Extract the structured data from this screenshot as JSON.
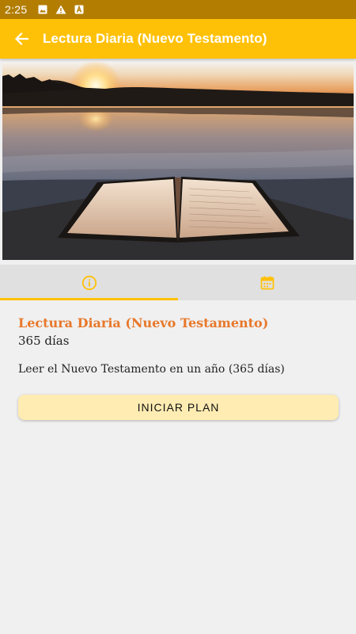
{
  "status_bar": {
    "time": "2:25",
    "icons": [
      "image-icon",
      "warning-icon",
      "app-icon"
    ]
  },
  "app_bar": {
    "title": "Lectura Diaria (Nuevo Testamento)",
    "back_icon": "arrow-back-icon"
  },
  "hero": {
    "image": "open-bible-on-dock-at-sunset"
  },
  "tabs": [
    {
      "icon": "info-icon",
      "active": true
    },
    {
      "icon": "calendar-icon",
      "active": false
    }
  ],
  "plan": {
    "title": "Lectura Diaria (Nuevo Testamento)",
    "days": "365 días",
    "description": "Leer el Nuevo Testamento en un año (365 días)",
    "start_label": "INICIAR PLAN"
  },
  "colors": {
    "app_bar": "#ffc107",
    "status_bar": "#b27d00",
    "title_accent": "#e8782a",
    "button_bg": "#ffecb3",
    "tab_bg": "#e0e0e0"
  }
}
